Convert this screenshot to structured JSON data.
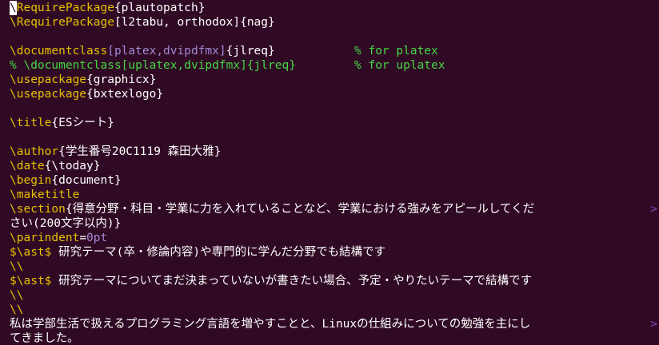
{
  "editor": {
    "background": "#300a24",
    "lines": {
      "l1": {
        "cursor": "\\",
        "cmd": "RequirePackage",
        "arg": "{plautopatch}"
      },
      "l2": {
        "cmd": "\\RequirePackage",
        "opt": "[l2tabu, orthodox]",
        "arg": "{nag}"
      },
      "l4": {
        "cmd": "\\documentclass",
        "opt": "[platex,dvipdfmx]",
        "arg": "{jlreq}",
        "comment": "% for platex"
      },
      "l5": {
        "text": "% \\documentclass[uplatex,dvipdfmx]{jlreq}",
        "comment": "% for uplatex"
      },
      "l6": {
        "cmd": "\\usepackage",
        "arg": "{graphicx}"
      },
      "l7": {
        "cmd": "\\usepackage",
        "arg": "{bxtexlogo}"
      },
      "l9": {
        "cmd": "\\title",
        "arg": "{ESシート}"
      },
      "l11": {
        "cmd": "\\author",
        "arg": "{学生番号20C1119 森田大雅}"
      },
      "l12": {
        "cmd": "\\date",
        "arg": "{\\today}"
      },
      "l13": {
        "cmd": "\\begin",
        "arg": "{document}"
      },
      "l14": {
        "cmd": "\\maketitle"
      },
      "l15": {
        "cmd": "\\section",
        "arg": "{得意分野・科目・学業に力を入れていることなど、学業における強みをアピールしてくだ"
      },
      "l15b": {
        "text": "さい(200文字以内)}"
      },
      "l16": {
        "cmd": "\\parindent",
        "eq": "=",
        "val": "0pt"
      },
      "l17": {
        "dollar": "$",
        "cmd": "\\ast",
        "dollar2": "$",
        "text": " 研究テーマ(卒・修論内容)や専門的に学んだ分野でも結構です"
      },
      "l18": {
        "text": "\\\\"
      },
      "l19": {
        "dollar": "$",
        "cmd": "\\ast",
        "dollar2": "$",
        "text": " 研究テーマについてまだ決まっていないが書きたい場合、予定・やりたいテーマで結構です"
      },
      "l20": {
        "text": "\\\\"
      },
      "l21": {
        "text": "\\\\"
      },
      "l22": {
        "text": "私は学部生活で扱えるプログラミング言語を増やすことと、Linuxの仕組みについての勉強を主にし"
      },
      "l22b": {
        "text": "てきました。"
      },
      "wrap": ">"
    }
  }
}
